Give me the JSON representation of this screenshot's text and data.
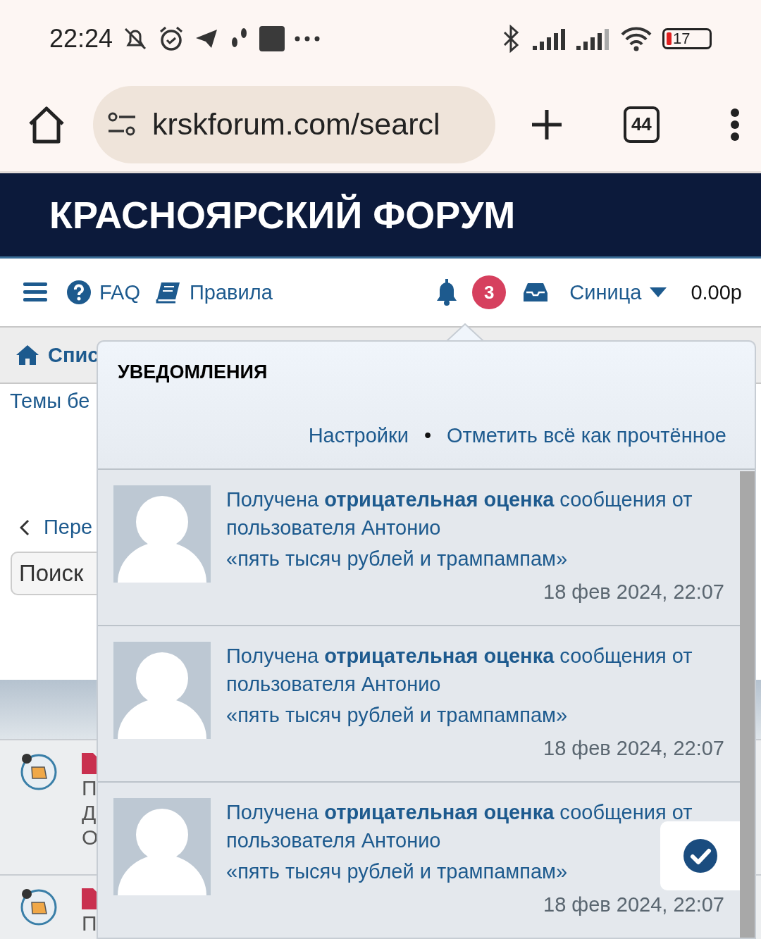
{
  "status_bar": {
    "time": "22:24",
    "battery": "17"
  },
  "browser": {
    "url": "krskforum.com/searcl",
    "tab_count": "44"
  },
  "site": {
    "title": "КРАСНОЯРСКИЙ ФОРУМ"
  },
  "nav": {
    "faq": "FAQ",
    "rules": "Правила",
    "notification_count": "3",
    "username": "Синица",
    "balance": "0.00р"
  },
  "page": {
    "breadcrumb": "Спис",
    "subtitle": "Темы бе",
    "back_link": "Пере",
    "search": {
      "placeholder": "Поиск"
    },
    "rows": [
      {
        "lines": [
          "П",
          "Д",
          "О"
        ]
      },
      {
        "lines": [
          "П"
        ]
      }
    ]
  },
  "notifications": {
    "title": "УВЕДОМЛЕНИЯ",
    "settings": "Настройки",
    "separator": "•",
    "mark_all_read": "Отметить всё как прочтённое",
    "items": [
      {
        "text": "Получена **отрицательная оценка** сообщения от пользователя Антонио",
        "quote": "«пять тысяч рублей и трампампам»",
        "time": "18 фев 2024, 22:07"
      },
      {
        "text": "Получена **отрицательная оценка** сообщения от пользователя Антонио",
        "quote": "«пять тысяч рублей и трампампам»",
        "time": "18 фев 2024, 22:07"
      },
      {
        "text": "Получена **отрицательная оценка** сообщения от пользователя Антонио",
        "quote": "«пять тысяч рублей и трампампам»",
        "time": "18 фев 2024, 22:07"
      }
    ]
  }
}
